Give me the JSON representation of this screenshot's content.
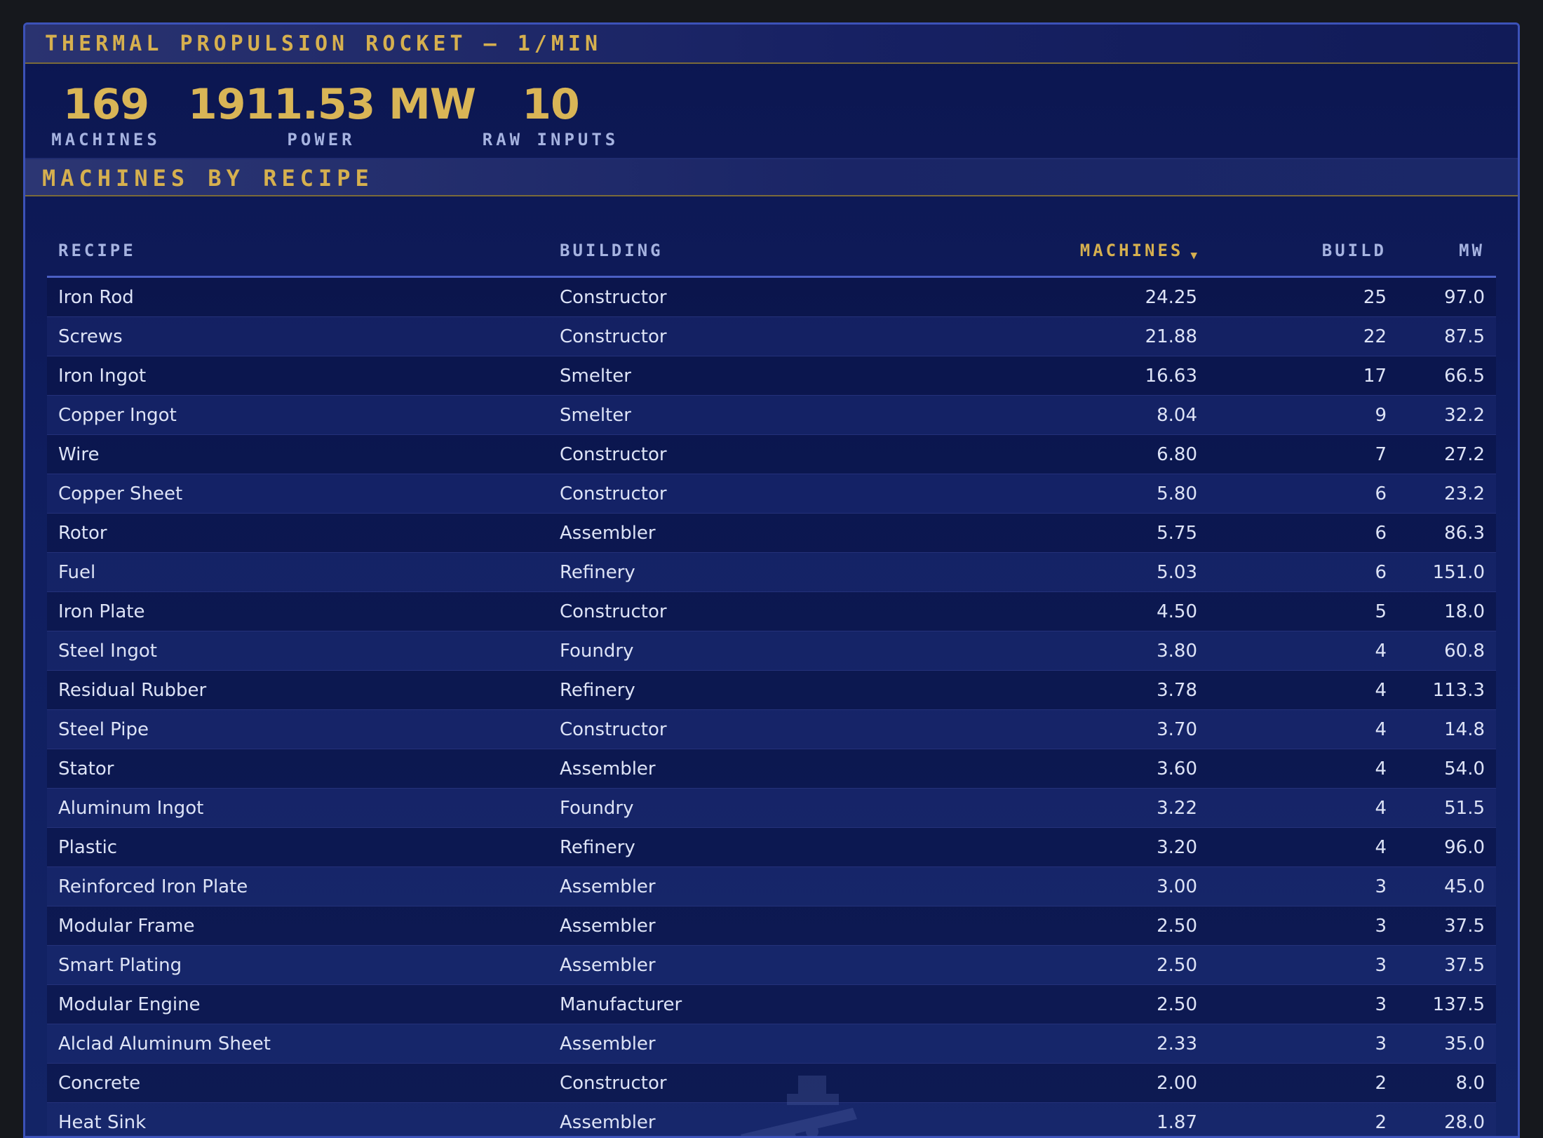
{
  "title": "THERMAL PROPULSION ROCKET — 1/MIN",
  "stats": {
    "machines": {
      "value": "169",
      "label": "MACHINES"
    },
    "power": {
      "value": "1911.53 MW",
      "label": "POWER"
    },
    "raw_inputs": {
      "value": "10",
      "label": "RAW INPUTS"
    }
  },
  "section_title": "MACHINES BY RECIPE",
  "table": {
    "columns": {
      "recipe": "RECIPE",
      "building": "BUILDING",
      "machines": "MACHINES",
      "build": "BUILD",
      "mw": "MW"
    },
    "sort_indicator": "▼",
    "rows": [
      {
        "recipe": "Iron Rod",
        "building": "Constructor",
        "machines": "24.25",
        "build": "25",
        "mw": "97.0"
      },
      {
        "recipe": "Screws",
        "building": "Constructor",
        "machines": "21.88",
        "build": "22",
        "mw": "87.5"
      },
      {
        "recipe": "Iron Ingot",
        "building": "Smelter",
        "machines": "16.63",
        "build": "17",
        "mw": "66.5"
      },
      {
        "recipe": "Copper Ingot",
        "building": "Smelter",
        "machines": "8.04",
        "build": "9",
        "mw": "32.2"
      },
      {
        "recipe": "Wire",
        "building": "Constructor",
        "machines": "6.80",
        "build": "7",
        "mw": "27.2"
      },
      {
        "recipe": "Copper Sheet",
        "building": "Constructor",
        "machines": "5.80",
        "build": "6",
        "mw": "23.2"
      },
      {
        "recipe": "Rotor",
        "building": "Assembler",
        "machines": "5.75",
        "build": "6",
        "mw": "86.3"
      },
      {
        "recipe": "Fuel",
        "building": "Refinery",
        "machines": "5.03",
        "build": "6",
        "mw": "151.0"
      },
      {
        "recipe": "Iron Plate",
        "building": "Constructor",
        "machines": "4.50",
        "build": "5",
        "mw": "18.0"
      },
      {
        "recipe": "Steel Ingot",
        "building": "Foundry",
        "machines": "3.80",
        "build": "4",
        "mw": "60.8"
      },
      {
        "recipe": "Residual Rubber",
        "building": "Refinery",
        "machines": "3.78",
        "build": "4",
        "mw": "113.3"
      },
      {
        "recipe": "Steel Pipe",
        "building": "Constructor",
        "machines": "3.70",
        "build": "4",
        "mw": "14.8"
      },
      {
        "recipe": "Stator",
        "building": "Assembler",
        "machines": "3.60",
        "build": "4",
        "mw": "54.0"
      },
      {
        "recipe": "Aluminum Ingot",
        "building": "Foundry",
        "machines": "3.22",
        "build": "4",
        "mw": "51.5"
      },
      {
        "recipe": "Plastic",
        "building": "Refinery",
        "machines": "3.20",
        "build": "4",
        "mw": "96.0"
      },
      {
        "recipe": "Reinforced Iron Plate",
        "building": "Assembler",
        "machines": "3.00",
        "build": "3",
        "mw": "45.0"
      },
      {
        "recipe": "Modular Frame",
        "building": "Assembler",
        "machines": "2.50",
        "build": "3",
        "mw": "37.5"
      },
      {
        "recipe": "Smart Plating",
        "building": "Assembler",
        "machines": "2.50",
        "build": "3",
        "mw": "37.5"
      },
      {
        "recipe": "Modular Engine",
        "building": "Manufacturer",
        "machines": "2.50",
        "build": "3",
        "mw": "137.5"
      },
      {
        "recipe": "Alclad Aluminum Sheet",
        "building": "Assembler",
        "machines": "2.33",
        "build": "3",
        "mw": "35.0"
      },
      {
        "recipe": "Concrete",
        "building": "Constructor",
        "machines": "2.00",
        "build": "2",
        "mw": "8.0"
      },
      {
        "recipe": "Heat Sink",
        "building": "Assembler",
        "machines": "1.87",
        "build": "2",
        "mw": "28.0"
      }
    ]
  },
  "colors": {
    "accent": "#d6b04f",
    "panel": "#0f1d5e",
    "border": "#3c52b8",
    "label": "#a6b3e0",
    "text": "#dde3f6"
  },
  "icons": {
    "watermark": "factory-cart-icon"
  }
}
